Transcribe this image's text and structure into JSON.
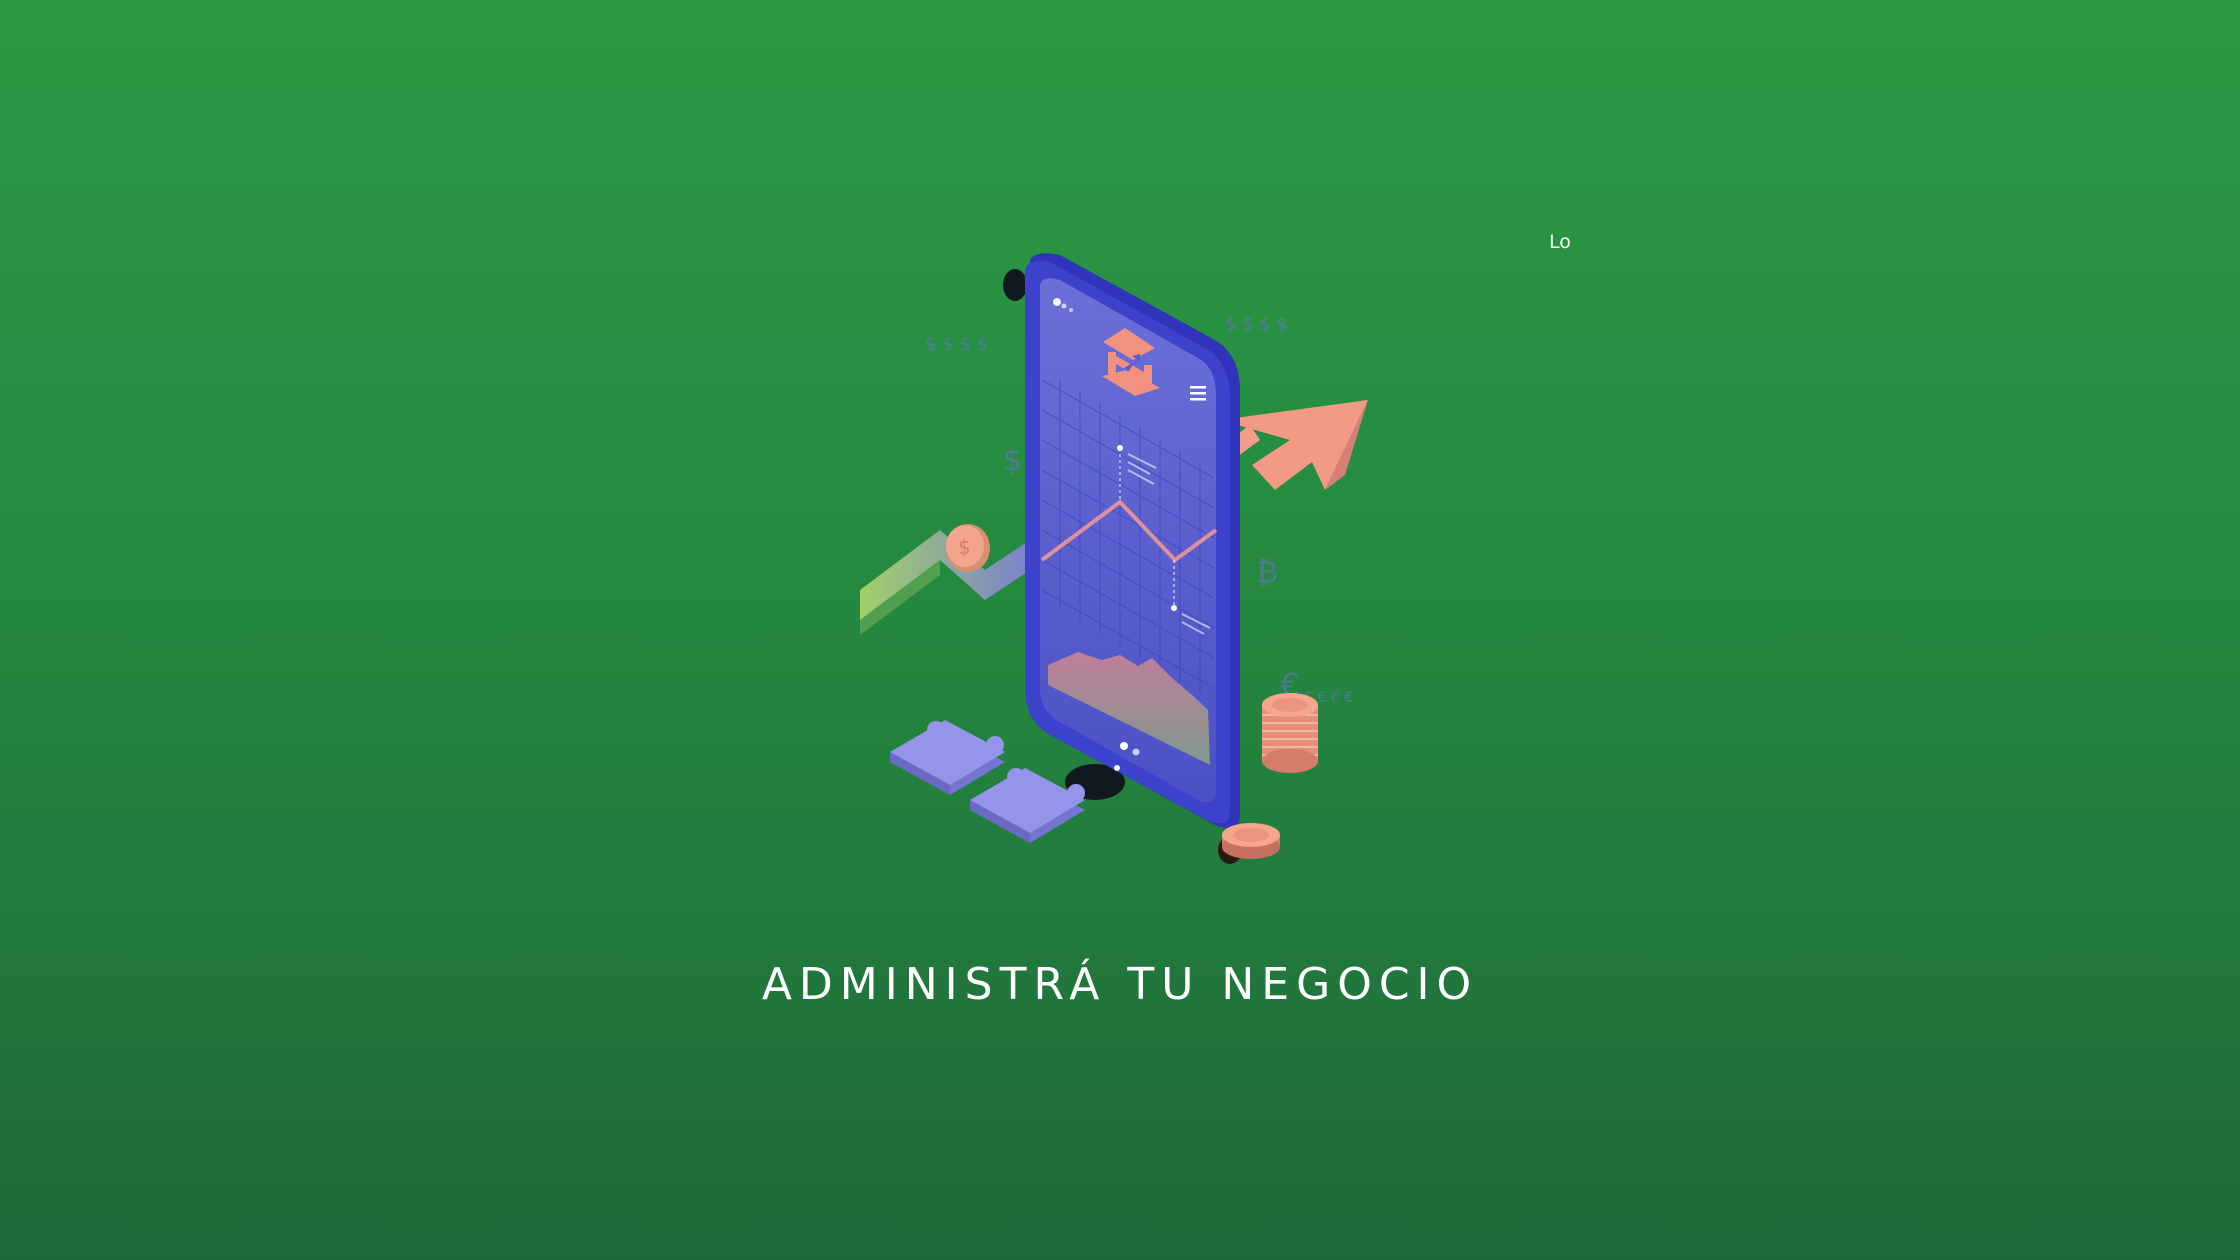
{
  "splash": {
    "loading_text": "Lo",
    "headline": "ADMINISTRÁ TU NEGOCIO"
  },
  "illustration": {
    "subject": "isometric smartphone with banking app, rising arrow, coins and puzzle pieces",
    "icons": [
      "bank-icon",
      "menu-icon",
      "growth-arrow",
      "coin-stack",
      "puzzle-piece",
      "dollar-sign",
      "euro-sign",
      "bitcoin-sign"
    ]
  },
  "colors": {
    "background_top": "#2d9a45",
    "background_bottom": "#1e693a",
    "phone_body": "#3a3fc4",
    "phone_screen": "#5a5fd0",
    "accent_salmon": "#f0907a",
    "puzzle": "#8f8fe6"
  }
}
